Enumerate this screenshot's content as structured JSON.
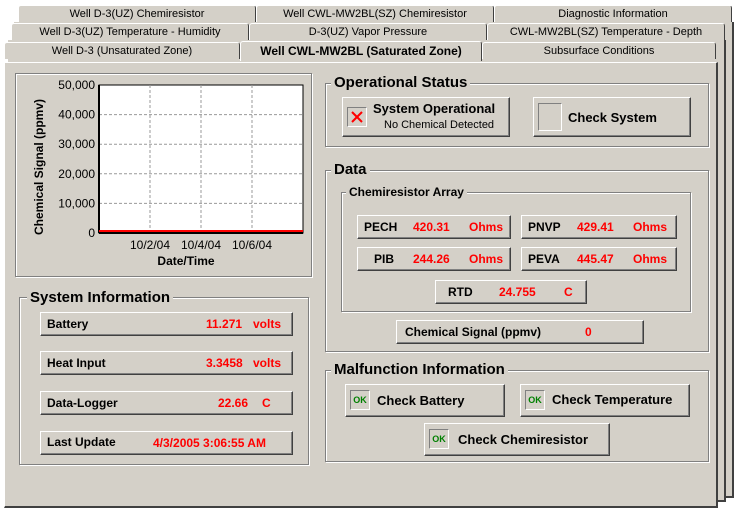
{
  "tabs": {
    "row1": [
      "Well D-3(UZ) Chemiresistor",
      "Well CWL-MW2BL(SZ) Chemiresistor",
      "Diagnostic Information"
    ],
    "row2": [
      "Well D-3(UZ) Temperature - Humidity",
      "D-3(UZ) Vapor Pressure",
      "CWL-MW2BL(SZ) Temperature - Depth"
    ],
    "row3": [
      "Well D-3 (Unsaturated Zone)",
      "Well CWL-MW2BL (Saturated Zone)",
      "Subsurface Conditions"
    ]
  },
  "chart_data": {
    "type": "line",
    "title": "",
    "xlabel": "Date/Time",
    "ylabel": "Chemical Signal (ppmv)",
    "ylim": [
      0,
      50000
    ],
    "yticks": [
      "50,000",
      "40,000",
      "30,000",
      "20,000",
      "10,000",
      "0"
    ],
    "xticks": [
      "10/2/04",
      "10/4/04",
      "10/6/04"
    ],
    "grid": true,
    "series": [
      {
        "x": [
          "9/30/04",
          "10/7/04"
        ],
        "values": [
          0,
          0
        ],
        "color": "#ff0000"
      }
    ]
  },
  "system_info": {
    "title": "System Information",
    "rows": [
      {
        "label": "Battery",
        "value": "11.271",
        "unit": "volts"
      },
      {
        "label": "Heat Input",
        "value": "3.3458",
        "unit": "volts"
      },
      {
        "label": "Data-Logger",
        "value": "22.66",
        "unit": "C"
      },
      {
        "label": "Last Update",
        "value": "4/3/2005 3:06:55 AM",
        "unit": ""
      }
    ]
  },
  "operational": {
    "title": "Operational Status",
    "status_label": "System Operational",
    "status_sub": "No Chemical Detected",
    "status_icon": "x-icon",
    "check_system_label": "Check System"
  },
  "data_section": {
    "title": "Data",
    "array_title": "Chemiresistor Array",
    "sensors": [
      {
        "label": "PECH",
        "value": "420.31",
        "unit": "Ohms"
      },
      {
        "label": "PNVP",
        "value": "429.41",
        "unit": "Ohms"
      },
      {
        "label": "PIB",
        "value": "244.26",
        "unit": "Ohms"
      },
      {
        "label": "PEVA",
        "value": "445.47",
        "unit": "Ohms"
      }
    ],
    "rtd": {
      "label": "RTD",
      "value": "24.755",
      "unit": "C"
    },
    "chemical_signal": {
      "label": "Chemical Signal (ppmv)",
      "value": "0"
    }
  },
  "malfunction": {
    "title": "Malfunction Information",
    "ok_text": "OK",
    "check_battery": "Check Battery",
    "check_temperature": "Check Temperature",
    "check_chemiresistor": "Check Chemiresistor"
  },
  "colors": {
    "face": "#d4d0c8",
    "value": "#ff0000",
    "ok": "#008000"
  }
}
